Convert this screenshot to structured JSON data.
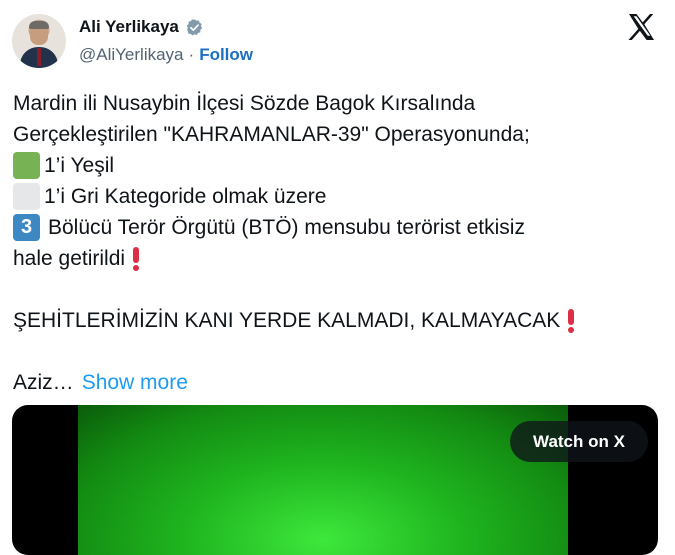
{
  "author": {
    "name": "Ali Yerlikaya",
    "handle": "@AliYerlikaya",
    "separator": "·",
    "follow_label": "Follow"
  },
  "icons": {
    "brand": "x-logo-icon",
    "verified": "verified-badge-icon"
  },
  "tweet": {
    "line1": "Mardin ili Nusaybin İlçesi Sözde Bagok Kırsalında",
    "line2": "Gerçekleştirilen \"KAHRAMANLAR-39\" Operasyonunda;",
    "line3": "1’i Yeşil",
    "line4": "1’i Gri Kategoride olmak üzere",
    "line5_digit": "3",
    "line5": "Bölücü Terör Örgütü (BTÖ) mensubu terörist etkisiz",
    "line6": "hale getirildi",
    "line7": "ŞEHİTLERİMİZİN KANI YERDE KALMADI, KALMAYACAK",
    "line8": "Aziz…",
    "show_more": "Show more"
  },
  "media": {
    "watch_label": "Watch on X"
  },
  "colors": {
    "link": "#1d9bf0",
    "follow": "#1d6fc0",
    "verified": "#829aab",
    "video_green": "#2fd12f"
  }
}
